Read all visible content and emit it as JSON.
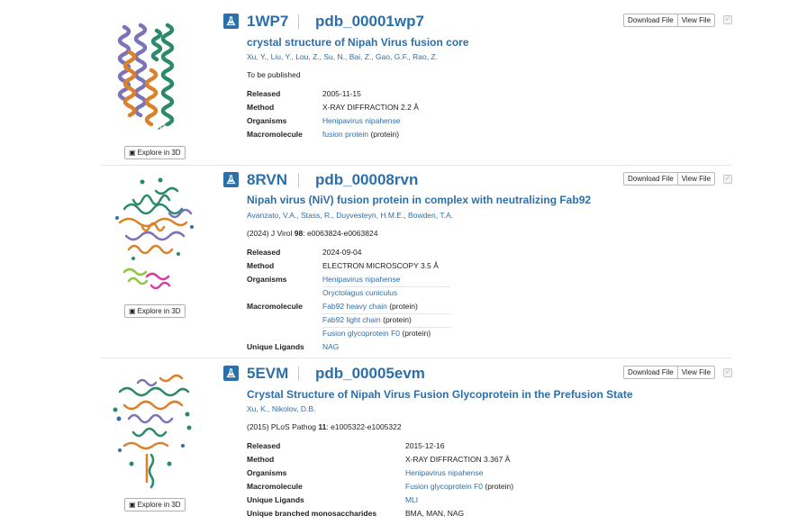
{
  "entries": [
    {
      "id": "1WP7",
      "code": "pdb_00001wp7",
      "title": "crystal structure of Nipah Virus fusion core",
      "authors": "Xu, Y., Liu, Y., Lou, Z., Su, N., Bai, Z., Gao, G.F., Rao, Z.",
      "citation": {
        "prefix": "To be published",
        "bold": "",
        "suffix": ""
      },
      "released": "2005-11-15",
      "method": "X-RAY DIFFRACTION 2.2 Å",
      "organisms": [
        "Henipavirus nipahense"
      ],
      "macromolecules": [
        {
          "name": "fusion protein",
          "type": "(protein)"
        }
      ],
      "ligands": "",
      "branched": ""
    },
    {
      "id": "8RVN",
      "code": "pdb_00008rvn",
      "title": "Nipah virus (NiV) fusion protein in complex with neutralizing Fab92",
      "authors": "Avanzato, V.A., Stass, R., Duyvesteyn, H.M.E., Bowden, T.A.",
      "citation": {
        "prefix": "(2024) J Virol ",
        "bold": "98",
        "suffix": ": e0063824-e0063824"
      },
      "released": "2024-09-04",
      "method": "ELECTRON MICROSCOPY 3.5 Å",
      "organisms": [
        "Henipavirus nipahense",
        "Oryctolagus cuniculus"
      ],
      "macromolecules": [
        {
          "name": "Fab92 heavy chain",
          "type": "(protein)"
        },
        {
          "name": "Fab92 light chain",
          "type": "(protein)"
        },
        {
          "name": "Fusion glycoprotein F0",
          "type": "(protein)"
        }
      ],
      "ligands": "NAG",
      "branched": ""
    },
    {
      "id": "5EVM",
      "code": "pdb_00005evm",
      "title": "Crystal Structure of Nipah Virus Fusion Glycoprotein in the Prefusion State",
      "authors": "Xu, K., Nikolov, D.B.",
      "citation": {
        "prefix": "(2015) PLoS Pathog ",
        "bold": "11",
        "suffix": ": e1005322-e1005322"
      },
      "released": "2015-12-16",
      "method": "X-RAY DIFFRACTION 3.367 Å",
      "organisms": [
        "Henipavirus nipahense"
      ],
      "macromolecules": [
        {
          "name": "Fusion glycoprotein F0",
          "type": "(protein)"
        }
      ],
      "ligands": "MLI",
      "branched": "BMA, MAN, NAG"
    }
  ],
  "labels": {
    "released": "Released",
    "method": "Method",
    "organisms": "Organisms",
    "macromolecule": "Macromolecule",
    "ligands": "Unique Ligands",
    "branched": "Unique branched monosaccharides",
    "download": "Download File",
    "view": "View File",
    "explore": "Explore in 3D"
  },
  "colors": {
    "link": "#2d6fa8",
    "helix_purple": "#7b73b8",
    "helix_orange": "#d9822b",
    "helix_green": "#2a8a6a"
  }
}
